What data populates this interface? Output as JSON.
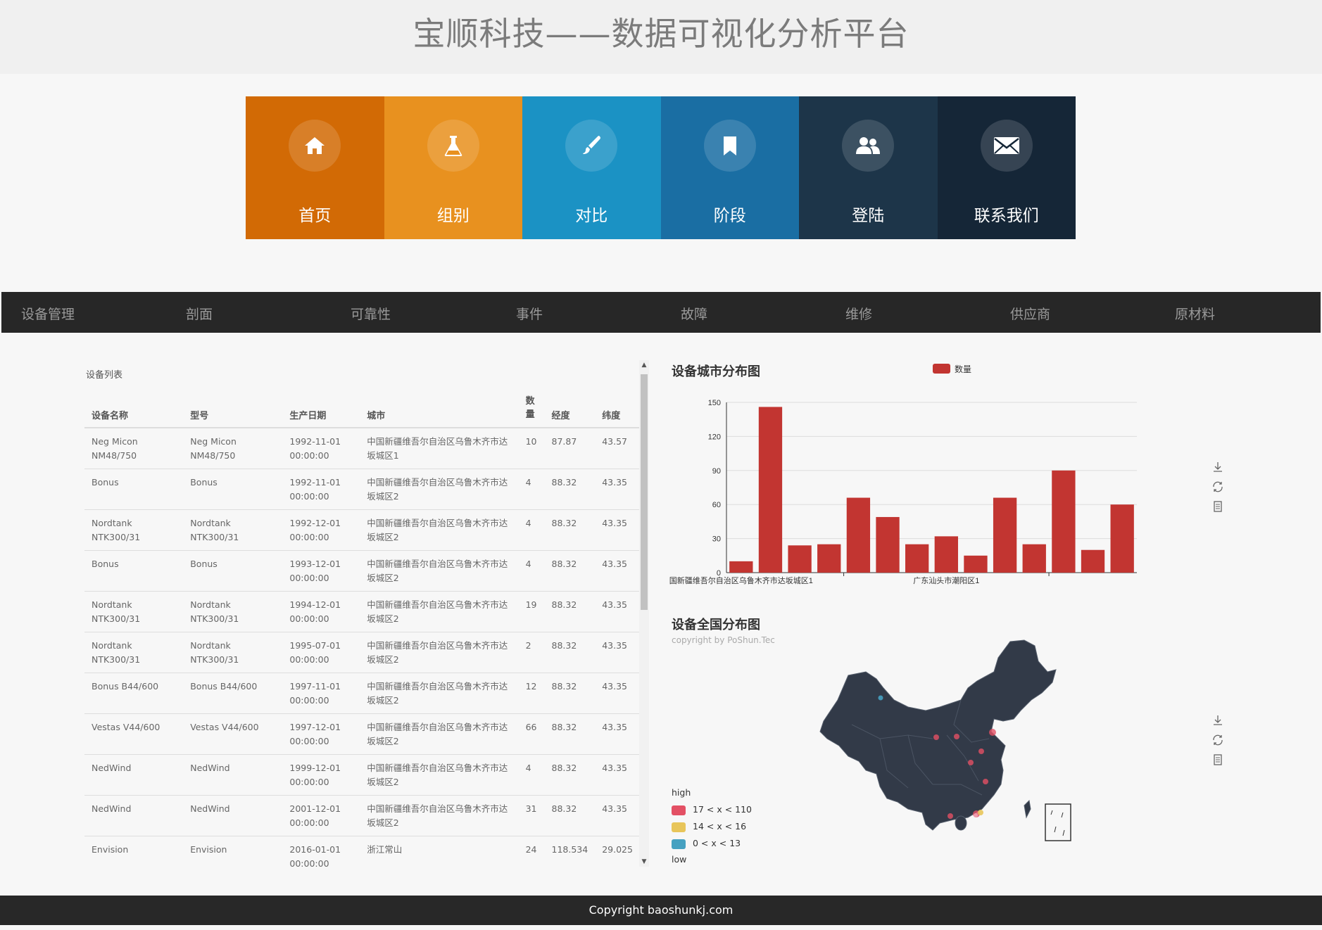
{
  "header": {
    "title": "宝顺科技——数据可视化分析平台"
  },
  "tiles": [
    {
      "label": "首页",
      "icon": "home-icon",
      "color": "#d26a05"
    },
    {
      "label": "组别",
      "icon": "flask-icon",
      "color": "#e8911f"
    },
    {
      "label": "对比",
      "icon": "brush-icon",
      "color": "#1b92c4"
    },
    {
      "label": "阶段",
      "icon": "bookmark-icon",
      "color": "#1a6ea3"
    },
    {
      "label": "登陆",
      "icon": "users-icon",
      "color": "#1d3549"
    },
    {
      "label": "联系我们",
      "icon": "envelope-icon",
      "color": "#152637"
    }
  ],
  "navbar": {
    "items": [
      "设备管理",
      "剖面",
      "可靠性",
      "事件",
      "故障",
      "维修",
      "供应商",
      "原材料"
    ]
  },
  "equipment_table": {
    "title": "设备列表",
    "columns": [
      "设备名称",
      "型号",
      "生产日期",
      "城市",
      "数量",
      "经度",
      "纬度"
    ],
    "rows": [
      [
        "Neg Micon NM48/750",
        "Neg Micon NM48/750",
        "1992-11-01 00:00:00",
        "中国新疆维吾尔自治区乌鲁木齐市达坂城区1",
        "10",
        "87.87",
        "43.57"
      ],
      [
        "Bonus",
        "Bonus",
        "1992-11-01 00:00:00",
        "中国新疆维吾尔自治区乌鲁木齐市达坂城区2",
        "4",
        "88.32",
        "43.35"
      ],
      [
        "Nordtank NTK300/31",
        "Nordtank NTK300/31",
        "1992-12-01 00:00:00",
        "中国新疆维吾尔自治区乌鲁木齐市达坂城区2",
        "4",
        "88.32",
        "43.35"
      ],
      [
        "Bonus",
        "Bonus",
        "1993-12-01 00:00:00",
        "中国新疆维吾尔自治区乌鲁木齐市达坂城区2",
        "4",
        "88.32",
        "43.35"
      ],
      [
        "Nordtank NTK300/31",
        "Nordtank NTK300/31",
        "1994-12-01 00:00:00",
        "中国新疆维吾尔自治区乌鲁木齐市达坂城区2",
        "19",
        "88.32",
        "43.35"
      ],
      [
        "Nordtank NTK300/31",
        "Nordtank NTK300/31",
        "1995-07-01 00:00:00",
        "中国新疆维吾尔自治区乌鲁木齐市达坂城区2",
        "2",
        "88.32",
        "43.35"
      ],
      [
        "Bonus B44/600",
        "Bonus B44/600",
        "1997-11-01 00:00:00",
        "中国新疆维吾尔自治区乌鲁木齐市达坂城区2",
        "12",
        "88.32",
        "43.35"
      ],
      [
        "Vestas V44/600",
        "Vestas V44/600",
        "1997-12-01 00:00:00",
        "中国新疆维吾尔自治区乌鲁木齐市达坂城区2",
        "66",
        "88.32",
        "43.35"
      ],
      [
        "NedWind",
        "NedWind",
        "1999-12-01 00:00:00",
        "中国新疆维吾尔自治区乌鲁木齐市达坂城区2",
        "4",
        "88.32",
        "43.35"
      ],
      [
        "NedWind",
        "NedWind",
        "2001-12-01 00:00:00",
        "中国新疆维吾尔自治区乌鲁木齐市达坂城区2",
        "31",
        "88.32",
        "43.35"
      ],
      [
        "Envision",
        "Envision",
        "2016-01-01 00:00:00",
        "浙江常山",
        "24",
        "118.534",
        "29.025"
      ]
    ]
  },
  "chart_data": [
    {
      "type": "bar",
      "title": "设备城市分布图",
      "series": [
        {
          "name": "数量",
          "values": [
            10,
            146,
            24,
            25,
            66,
            49,
            25,
            32,
            15,
            66,
            25,
            90,
            20,
            60
          ]
        }
      ],
      "categories": [
        "国新疆维吾尔自治区乌鲁木齐市达坂城区1",
        "",
        "",
        "",
        "",
        "",
        "",
        "广东汕头市潮阳区1",
        "",
        "",
        "",
        "",
        "",
        ""
      ],
      "ylim": [
        0,
        150
      ],
      "yticks": [
        0,
        30,
        60,
        90,
        120,
        150
      ],
      "color": "#c23531",
      "legend": "top-right",
      "grid": true
    }
  ],
  "map": {
    "title": "设备全国分布图",
    "subtitle": "copyright by PoShun.Tec",
    "legend_high": "high",
    "legend_low": "low",
    "pieces": [
      {
        "label": "17 < x < 110",
        "color": "#e35064"
      },
      {
        "label": "14 < x < 16",
        "color": "#e8c55a"
      },
      {
        "label": "0 < x < 13",
        "color": "#46a1c1"
      }
    ],
    "map_color": "#323a48"
  },
  "toolbox": {
    "icons": [
      "download-icon",
      "refresh-icon",
      "data-view-icon"
    ]
  },
  "footer": {
    "text": "Copyright baoshunkj.com"
  }
}
